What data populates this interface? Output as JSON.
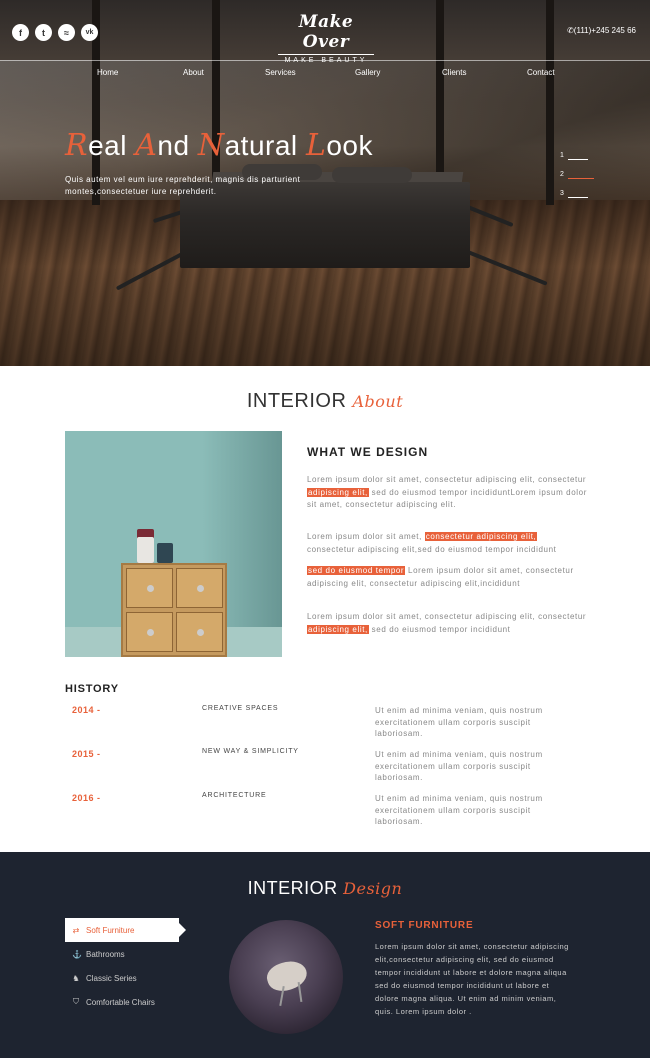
{
  "header": {
    "social": [
      {
        "icon": "facebook-icon",
        "glyph": "f"
      },
      {
        "icon": "twitter-icon",
        "glyph": "t"
      },
      {
        "icon": "rss-icon",
        "glyph": "≈"
      },
      {
        "icon": "vk-icon",
        "glyph": "vk"
      }
    ],
    "logo_main": "Make Over",
    "logo_sub": "MAKE BEAUTY",
    "phone": "(111)+245 245 66",
    "nav": [
      "Home",
      "About",
      "Services",
      "Gallery",
      "Clients",
      "Contact"
    ]
  },
  "hero": {
    "title_words": [
      {
        "cap": "R",
        "rest": "eal "
      },
      {
        "cap": "A",
        "rest": "nd "
      },
      {
        "cap": "N",
        "rest": "atural "
      },
      {
        "cap": "L",
        "rest": "ook"
      }
    ],
    "subtitle": "Quis autem vel eum iure reprehderit, magnis dis parturient montes,consectetuer iure reprehderit.",
    "slides": [
      "1",
      "2",
      "3"
    ]
  },
  "about": {
    "title_plain": "INTERIOR ",
    "title_script": "About",
    "what_title": "WHAT WE DESIGN",
    "p1a": "Lorem ipsum dolor sit amet, consectetur adipiscing elit, consectetur ",
    "p1h": "adipiscing elit,",
    "p1b": " sed do eiusmod tempor incididuntLorem ipsum dolor sit amet, consectetur adipiscing elit.",
    "p2a": "Lorem ipsum dolor sit amet, ",
    "p2h": "consectetur adipiscing elit,",
    "p2b": " consectetur adipiscing elit,sed do eiusmod tempor incididunt",
    "p3h": "sed do eiusmod tempor",
    "p3b": " Lorem ipsum dolor sit amet, consectetur adipiscing elit, consectetur adipiscing elit,incididunt",
    "p4a": "Lorem ipsum dolor sit amet, consectetur adipiscing elit, consectetur ",
    "p4h": "adipiscing elit,",
    "p4b": " sed do eiusmod tempor incididunt"
  },
  "history": {
    "title": "HISTORY",
    "rows": [
      {
        "year": "2014 -",
        "name": "CREATIVE SPACES",
        "desc": "Ut enim ad minima veniam, quis nostrum exercitationem ullam corporis suscipit laboriosam."
      },
      {
        "year": "2015 -",
        "name": "NEW WAY & SIMPLICITY",
        "desc": "Ut enim ad minima veniam, quis nostrum exercitationem ullam corporis suscipit laboriosam."
      },
      {
        "year": "2016 -",
        "name": "ARCHITECTURE",
        "desc": "Ut enim ad minima veniam, quis nostrum exercitationem ullam corporis suscipit laboriosam."
      }
    ]
  },
  "design": {
    "title_plain": "INTERIOR ",
    "title_script": "Design",
    "tabs": [
      {
        "label": "Soft Furniture",
        "icon": "shuffle-icon",
        "glyph": "⇄"
      },
      {
        "label": "Bathrooms",
        "icon": "anchor-icon",
        "glyph": "⚓"
      },
      {
        "label": "Classic Series",
        "icon": "chess-icon",
        "glyph": "♞"
      },
      {
        "label": "Comfortable Chairs",
        "icon": "shield-icon",
        "glyph": "⛉"
      }
    ],
    "panel_title": "SOFT FURNITURE",
    "panel_text": "Lorem ipsum dolor sit amet, consectetur adipiscing elit,consectetur adipiscing elit, sed do eiusmod tempor incididunt ut labore et dolore magna aliqua sed do eiusmod tempor incididunt ut labore et dolore magna aliqua. Ut enim ad minim veniam, quis. Lorem ipsum dolor ."
  },
  "colors": {
    "accent": "#e8613a",
    "dark_section": "#1e2430"
  }
}
